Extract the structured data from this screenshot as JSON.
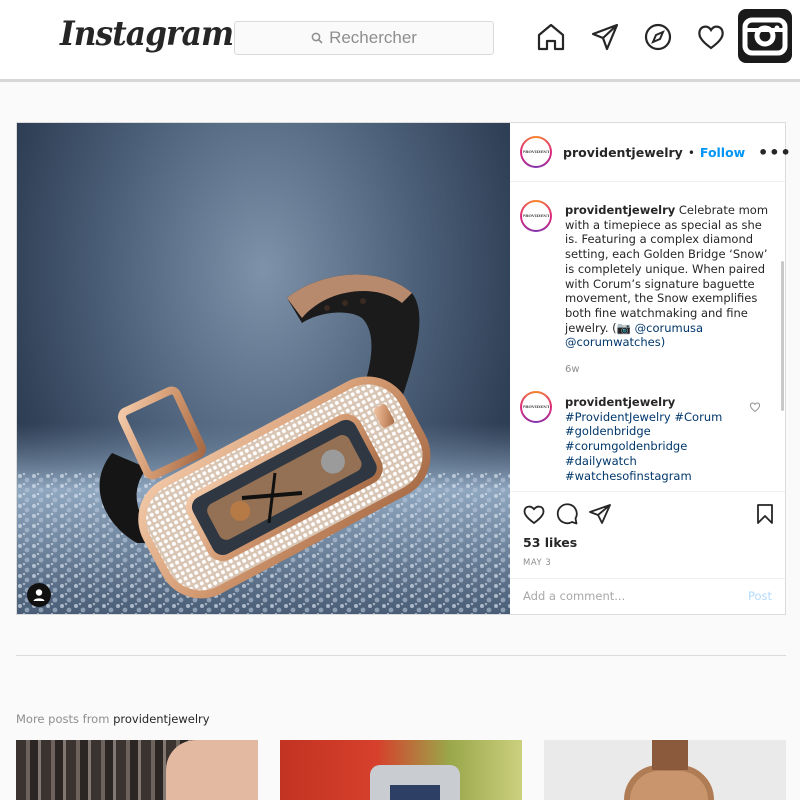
{
  "header": {
    "logo_text": "Instagram",
    "search_placeholder": "Rechercher"
  },
  "post": {
    "username": "providentjewelry",
    "separator": "•",
    "follow_label": "Follow",
    "more_label": "•••",
    "avatar_text": "PROVIDENT",
    "caption": {
      "username": "providentjewelry",
      "text": "Celebrate mom with a timepiece as special as she is. Featuring a complex diamond setting, each Golden Bridge ‘Snow’ is completely unique. When paired with Corum’s signature baguette movement, the Snow exemplifies both fine watchmaking and fine jewelry. (📷",
      "mention1": "@corumusa",
      "mention2": "@corumwatches)",
      "age": "6w"
    },
    "comment": {
      "username": "providentjewelry",
      "hashtags": [
        "#ProvidentJewelry #Corum",
        "#goldenbridge",
        "#corumgoldenbridge",
        "#dailywatch",
        "#watchesofinstagram"
      ]
    },
    "likes": "53 likes",
    "date": "MAY 3",
    "add_comment_placeholder": "Add a comment...",
    "post_button": "Post"
  },
  "more_posts": {
    "prefix": "More posts from",
    "username": "providentjewelry"
  },
  "colors": {
    "link_blue": "#0095f6",
    "hashtag_blue": "#00376b",
    "post_disabled": "#b3dbff"
  }
}
